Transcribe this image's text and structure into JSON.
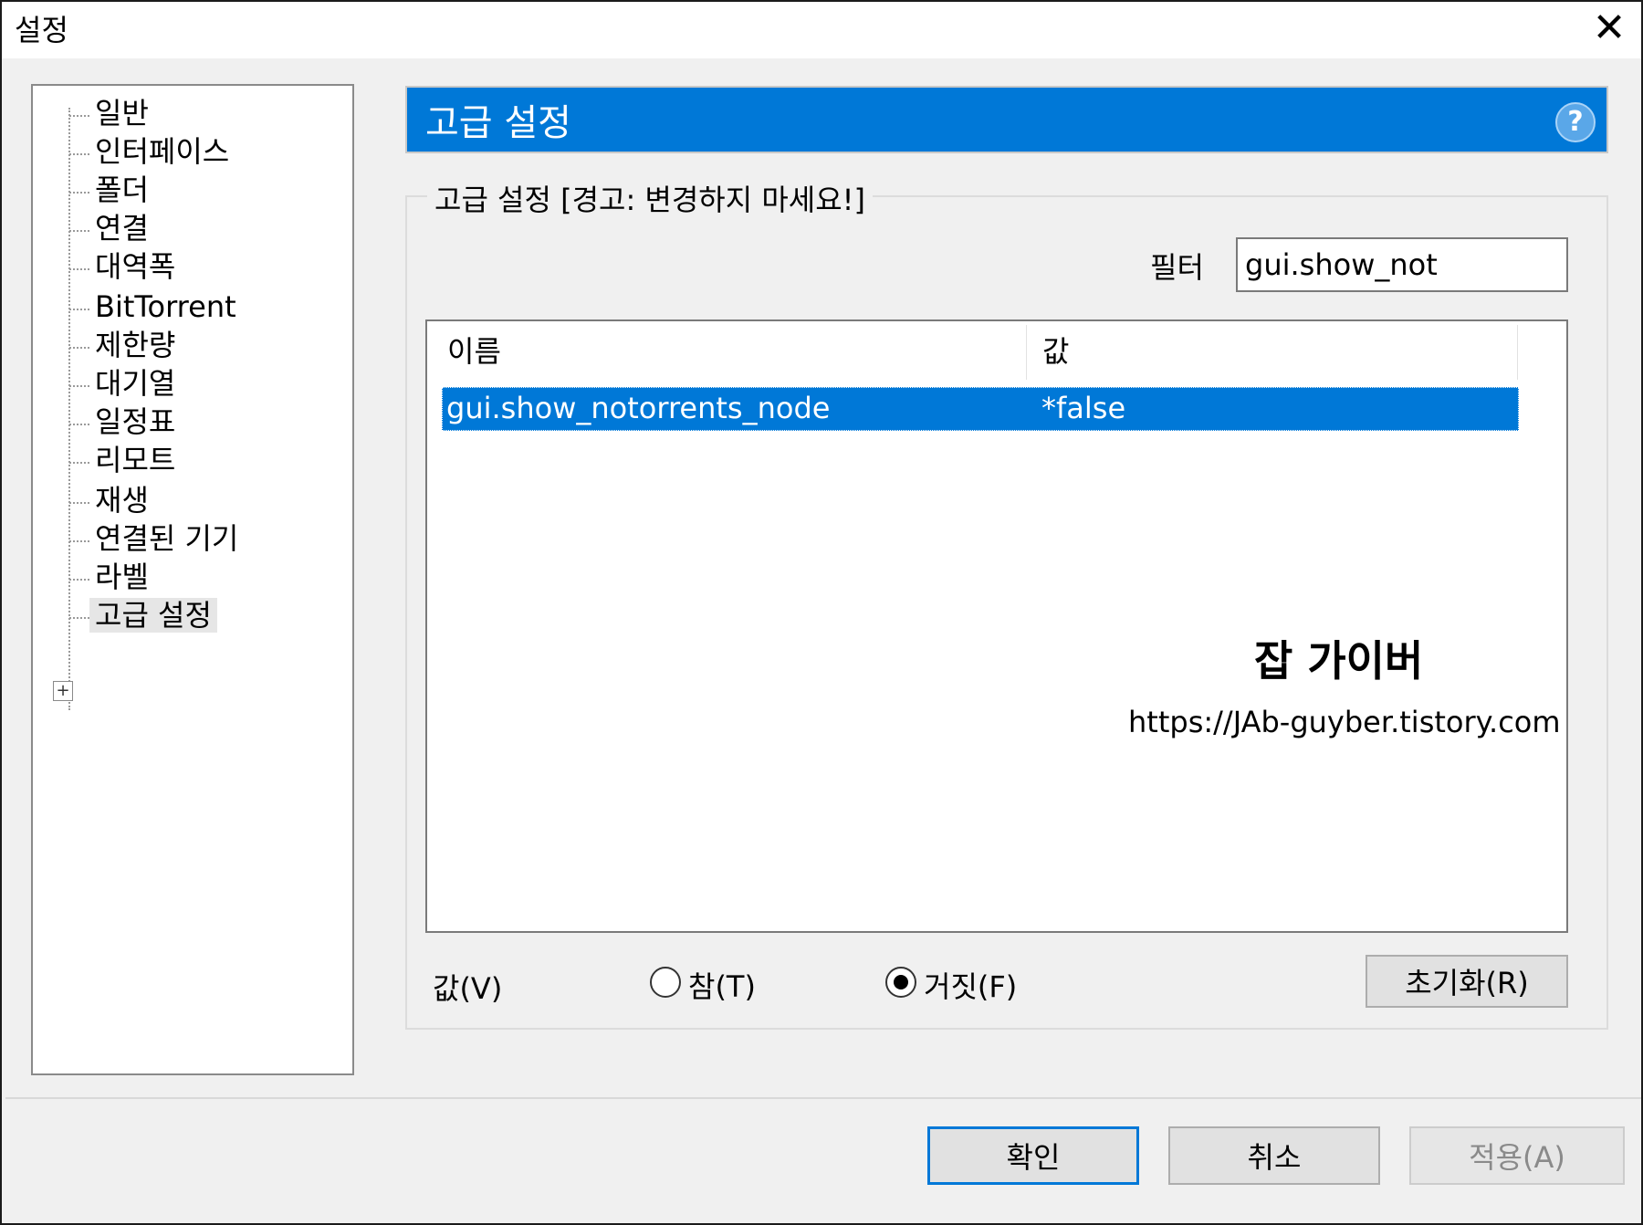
{
  "window": {
    "title": "설정",
    "close_glyph": "✕"
  },
  "sidebar": {
    "items": [
      {
        "label": "일반"
      },
      {
        "label": "인터페이스"
      },
      {
        "label": "폴더"
      },
      {
        "label": "연결"
      },
      {
        "label": "대역폭"
      },
      {
        "label": "BitTorrent"
      },
      {
        "label": "제한량"
      },
      {
        "label": "대기열"
      },
      {
        "label": "일정표"
      },
      {
        "label": "리모트"
      },
      {
        "label": "재생"
      },
      {
        "label": "연결된 기기"
      },
      {
        "label": "라벨"
      },
      {
        "label": "고급 설정"
      }
    ],
    "selected_index": 13,
    "expander_glyph": "+"
  },
  "header": {
    "title": "고급 설정",
    "help_glyph": "?"
  },
  "group": {
    "label": "고급 설정 [경고: 변경하지 마세요!]"
  },
  "filter": {
    "label": "필터",
    "value": "gui.show_not"
  },
  "list": {
    "columns": {
      "name": "이름",
      "value": "값"
    },
    "rows": [
      {
        "name": "gui.show_notorrents_node",
        "value": "*false"
      }
    ],
    "selected_index": 0
  },
  "watermark": {
    "title": "잡 가이버",
    "url": "https://JAb-guyber.tistory.com"
  },
  "value_editor": {
    "label": "값(V)",
    "true_label": "참(T)",
    "false_label": "거짓(F)",
    "selected": "false",
    "reset_label": "초기화(R)"
  },
  "footer": {
    "ok_label": "확인",
    "cancel_label": "취소",
    "apply_label": "적용(A)"
  },
  "colors": {
    "accent": "#0078d7",
    "selection": "#0078d7",
    "disabled_text": "#8a8a8a"
  }
}
